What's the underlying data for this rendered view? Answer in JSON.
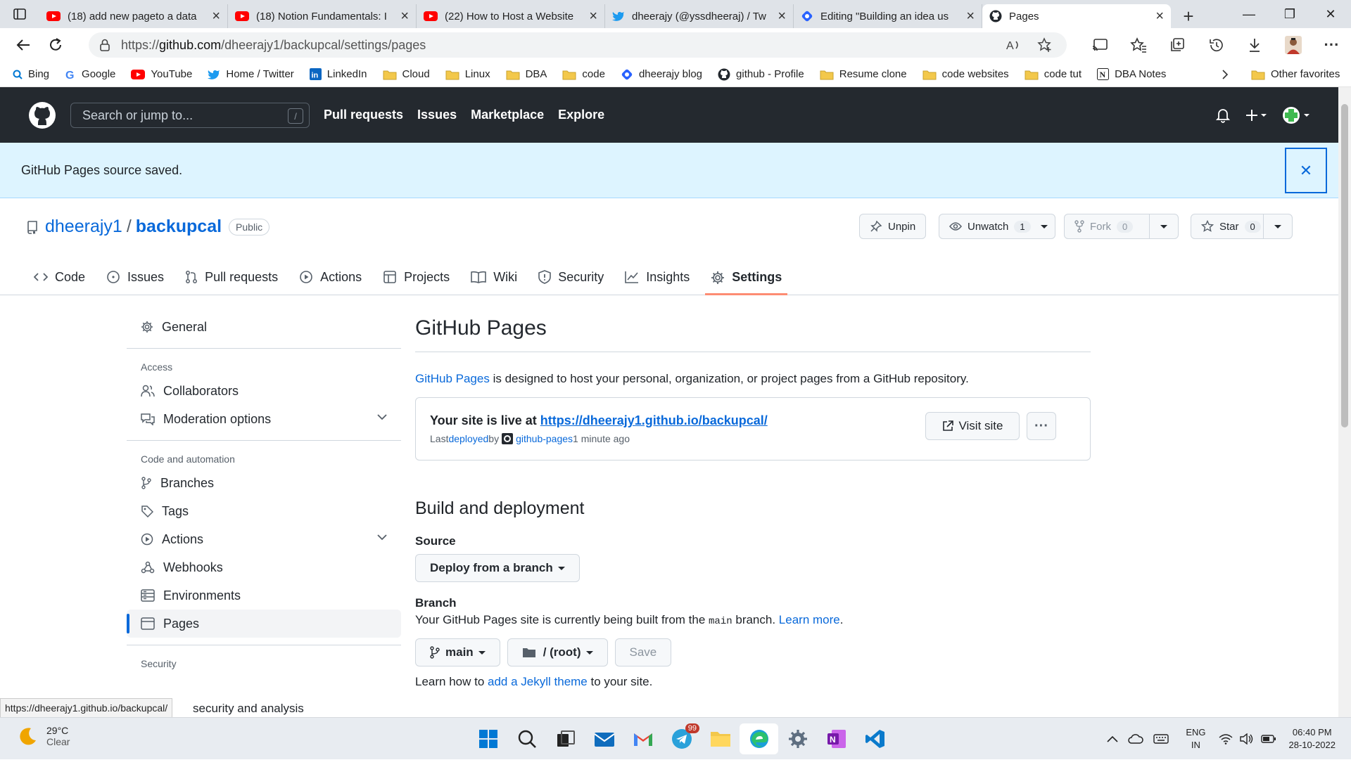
{
  "browser": {
    "tabs": [
      {
        "title": "(18) add new pageto a data",
        "icon": "youtube-icon"
      },
      {
        "title": "(18) Notion Fundamentals: I",
        "icon": "youtube-icon"
      },
      {
        "title": "(22) How to Host a Website",
        "icon": "youtube-icon"
      },
      {
        "title": "dheerajy (@yssdheeraj) / Tw",
        "icon": "twitter-icon"
      },
      {
        "title": "Editing \"Building an idea us",
        "icon": "hashnode-icon"
      },
      {
        "title": "Pages",
        "icon": "github-icon",
        "active": true
      }
    ],
    "url_prefix": "https://",
    "url_host": "github.com",
    "url_path": "/dheerajy1/backupcal/settings/pages",
    "favorites": [
      "Bing",
      "Google",
      "YouTube",
      "Home / Twitter",
      "LinkedIn",
      "Cloud",
      "Linux",
      "DBA",
      "code",
      "dheerajy blog",
      "github - Profile",
      "Resume clone",
      "code websites",
      "code tut",
      "DBA Notes"
    ],
    "other_favorites": "Other favorites"
  },
  "github": {
    "search_placeholder": "Search or jump to...",
    "search_key": "/",
    "nav": [
      "Pull requests",
      "Issues",
      "Marketplace",
      "Explore"
    ],
    "flash": "GitHub Pages source saved.",
    "owner": "dheerajy1",
    "repo": "backupcal",
    "visibility": "Public",
    "actions": {
      "unpin": "Unpin",
      "unwatch": "Unwatch",
      "watch_count": "1",
      "fork": "Fork",
      "fork_count": "0",
      "star": "Star",
      "star_count": "0"
    },
    "tabs": [
      "Code",
      "Issues",
      "Pull requests",
      "Actions",
      "Projects",
      "Wiki",
      "Security",
      "Insights",
      "Settings"
    ],
    "sidebar": {
      "general": "General",
      "access_head": "Access",
      "collaborators": "Collaborators",
      "moderation": "Moderation options",
      "code_head": "Code and automation",
      "branches": "Branches",
      "tags": "Tags",
      "actions": "Actions",
      "webhooks": "Webhooks",
      "environments": "Environments",
      "pages": "Pages",
      "security_head": "Security",
      "security_analysis": "security and analysis"
    },
    "main": {
      "title": "GitHub Pages",
      "desc_link": "GitHub Pages",
      "desc_rest": " is designed to host your personal, organization, or project pages from a GitHub repository.",
      "live_text": "Your site is live at ",
      "live_url": "https://dheerajy1.github.io/backupcal/",
      "last": "Last ",
      "deployed": "deployed",
      "by": " by ",
      "deployer": "github-pages",
      "time": " 1 minute ago",
      "visit": "Visit site",
      "more": "···",
      "build_title": "Build and deployment",
      "source_label": "Source",
      "source_value": "Deploy from a branch",
      "branch_label": "Branch",
      "branch_note_a": "Your GitHub Pages site is currently being built from the ",
      "branch_code": "main",
      "branch_note_b": " branch. ",
      "learn_more": "Learn more",
      "branch_btn": "main",
      "folder_btn": "/ (root)",
      "save": "Save",
      "jekyll_a": "Learn how to ",
      "jekyll_link": "add a Jekyll theme",
      "jekyll_b": " to your site."
    },
    "status_url": "https://dheerajy1.github.io/backupcal/"
  },
  "taskbar": {
    "temp": "29°C",
    "cond": "Clear",
    "lang1": "ENG",
    "lang2": "IN",
    "time": "06:40 PM",
    "date": "28-10-2022",
    "badge": "99"
  }
}
